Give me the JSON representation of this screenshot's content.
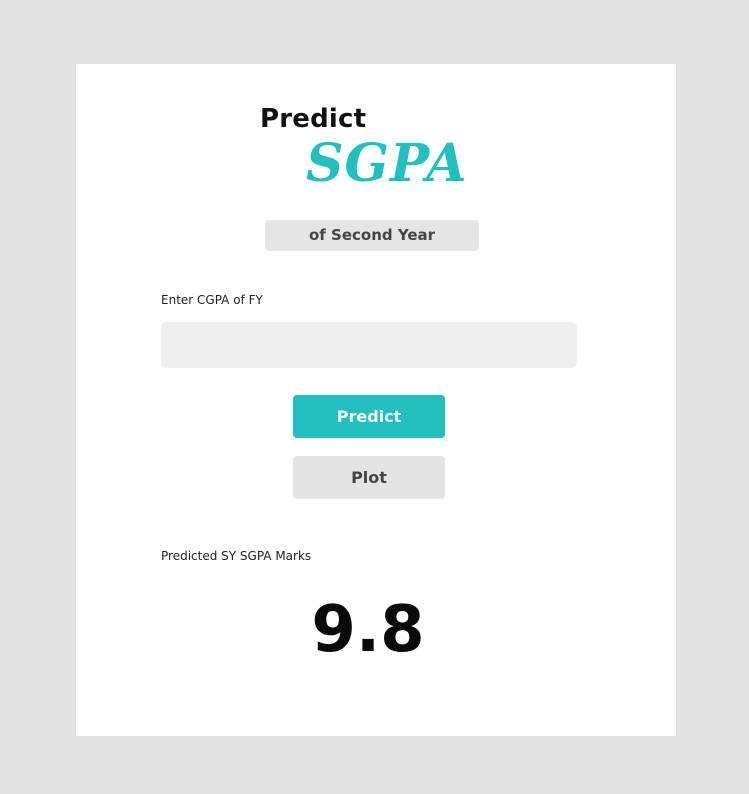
{
  "header": {
    "title_line1": "Predict",
    "title_line2": "SGPA",
    "subtitle": "of Second Year"
  },
  "form": {
    "input_label": "Enter CGPA of FY",
    "input_value": "",
    "input_placeholder": ""
  },
  "buttons": {
    "predict_label": "Predict",
    "plot_label": "Plot"
  },
  "result": {
    "label": "Predicted SY SGPA Marks",
    "value": "9.8"
  },
  "colors": {
    "accent": "#22bfbf",
    "page_background": "#e2e2e2",
    "card_background": "#ffffff",
    "input_background": "#efefef",
    "secondary_button": "#e4e4e4"
  }
}
